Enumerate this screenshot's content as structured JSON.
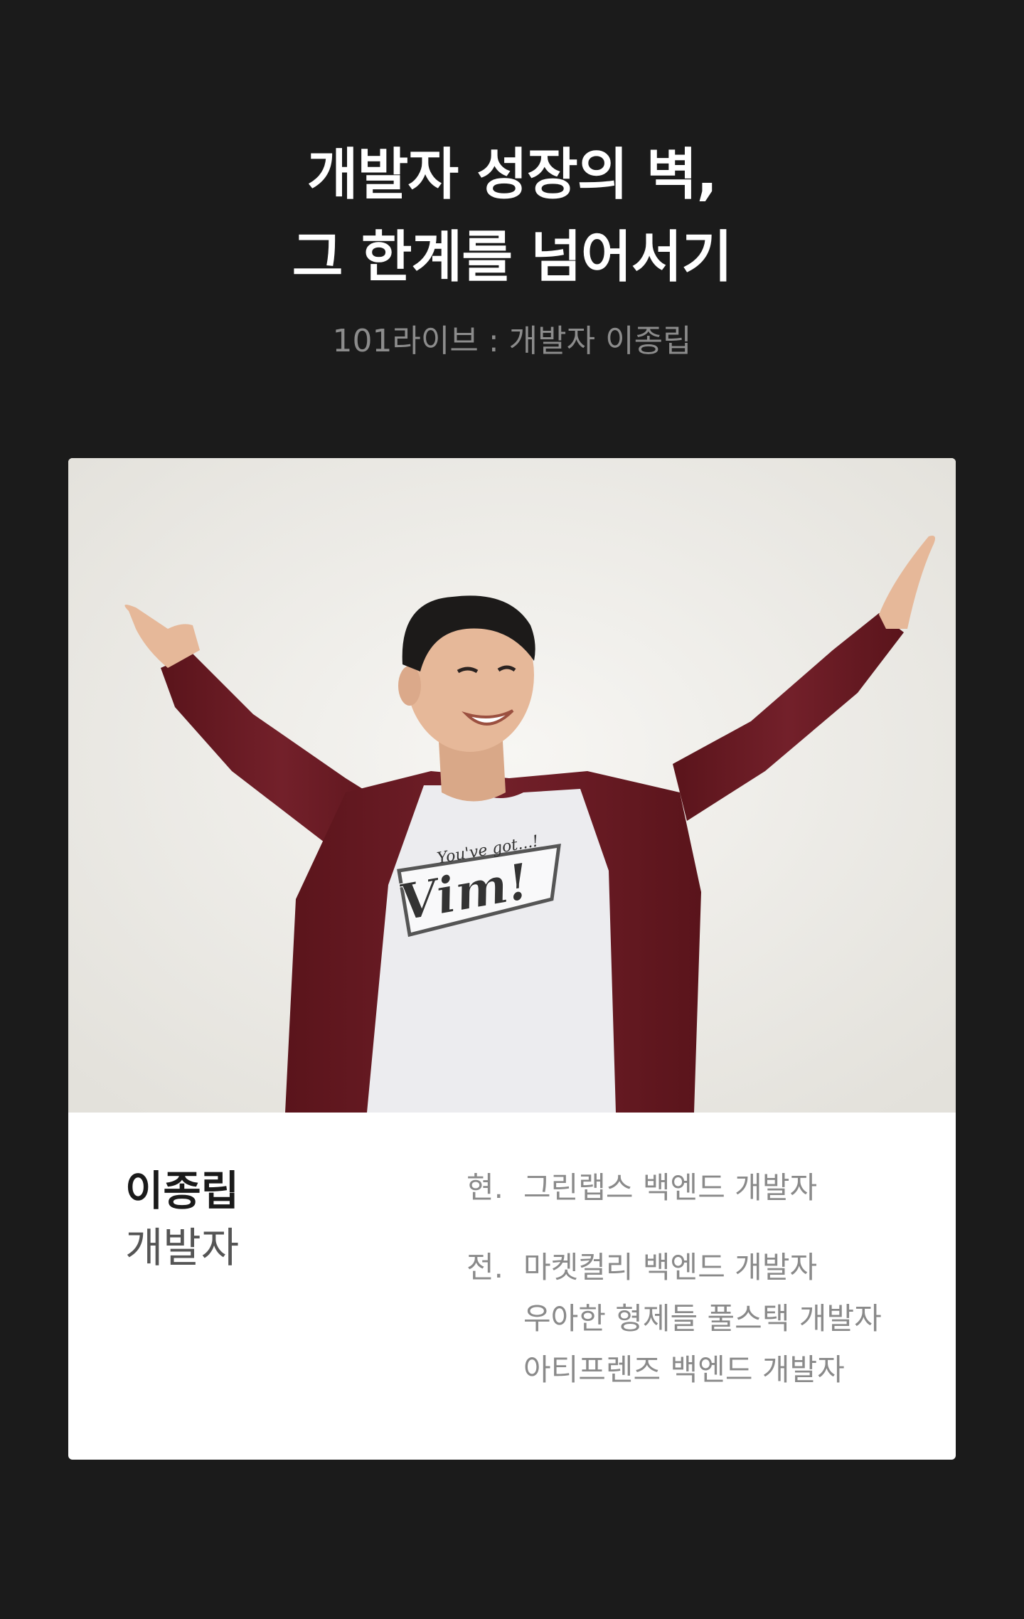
{
  "header": {
    "title_line1": "개발자 성장의 벽,",
    "title_line2": "그 한계를 넘어서기",
    "subtitle": "101라이브 : 개발자 이종립"
  },
  "profile": {
    "name": "이종립",
    "role": "개발자",
    "current_prefix": "현.",
    "current": [
      "그린랩스 백엔드 개발자"
    ],
    "former_prefix": "전.",
    "former": [
      "마켓컬리 백엔드 개발자",
      "우아한 형제들  풀스택 개발자",
      "아티프렌즈  백엔드 개발자"
    ]
  },
  "photo": {
    "shirt_text_small": "You've got...!",
    "shirt_text_large": "Vim!",
    "colors": {
      "jacket": "#6b1a22",
      "shirt": "#ececef",
      "skin": "#e6b899",
      "hair": "#1c1a19"
    }
  }
}
